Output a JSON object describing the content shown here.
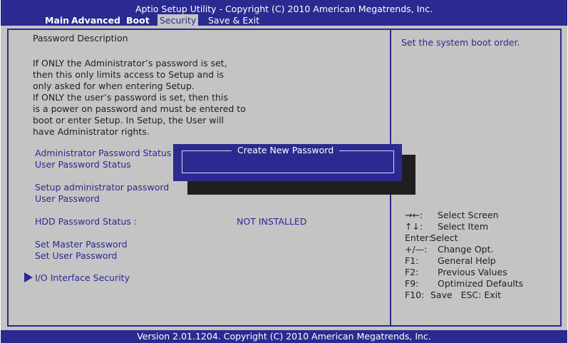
{
  "header": {
    "title": "Aptio Setup Utility - Copyright (C) 2010 American Megatrends, Inc.",
    "tabs": [
      {
        "label": "Main"
      },
      {
        "label": "Advanced"
      },
      {
        "label": "Boot"
      },
      {
        "label": "Security"
      },
      {
        "label": "Save & Exit"
      }
    ]
  },
  "main": {
    "description_heading": "Password Description",
    "description_lines": [
      "If ONLY the Administrator’s password is set,",
      "then this only limits access to Setup and is",
      "only asked for when entering Setup.",
      "If ONLY the user’s password is set, then this",
      "is a power on password and must be entered to",
      "boot or enter Setup. In Setup, the User will",
      "have Administrator rights."
    ],
    "admin_password_status_label": "Administrator Password Status",
    "user_password_status_label": "User Password Status",
    "setup_admin_password": "Setup administrator password",
    "user_password": "User Password",
    "hdd_password_status_label": "HDD Password Status :",
    "hdd_password_status_value": "NOT INSTALLED",
    "set_master_password": "Set Master Password",
    "set_user_password": "Set User Password",
    "io_interface_security": "I/O Interface Security"
  },
  "dialog": {
    "title": "Create New Password"
  },
  "help": {
    "text": "Set the system boot order.",
    "keys": [
      {
        "key": "→←:",
        "action": "Select Screen"
      },
      {
        "key": "↑↓:",
        "action": "Select Item"
      },
      {
        "key": "Enter:",
        "action": "Select"
      },
      {
        "key": "+/—:",
        "action": "Change Opt."
      },
      {
        "key": "F1:",
        "action": "General Help"
      },
      {
        "key": "F2:",
        "action": "Previous Values"
      },
      {
        "key": "F9:",
        "action": "Optimized Defaults"
      },
      {
        "key": "F10:",
        "action": "Save   ESC: Exit"
      }
    ]
  },
  "footer": {
    "text": "Version 2.01.1204. Copyright (C) 2010 American Megatrends, Inc."
  },
  "colors": {
    "bios_blue": "#2a2a90",
    "panel_gray": "#c4c4c4",
    "text_dark": "#1f1f1f"
  }
}
